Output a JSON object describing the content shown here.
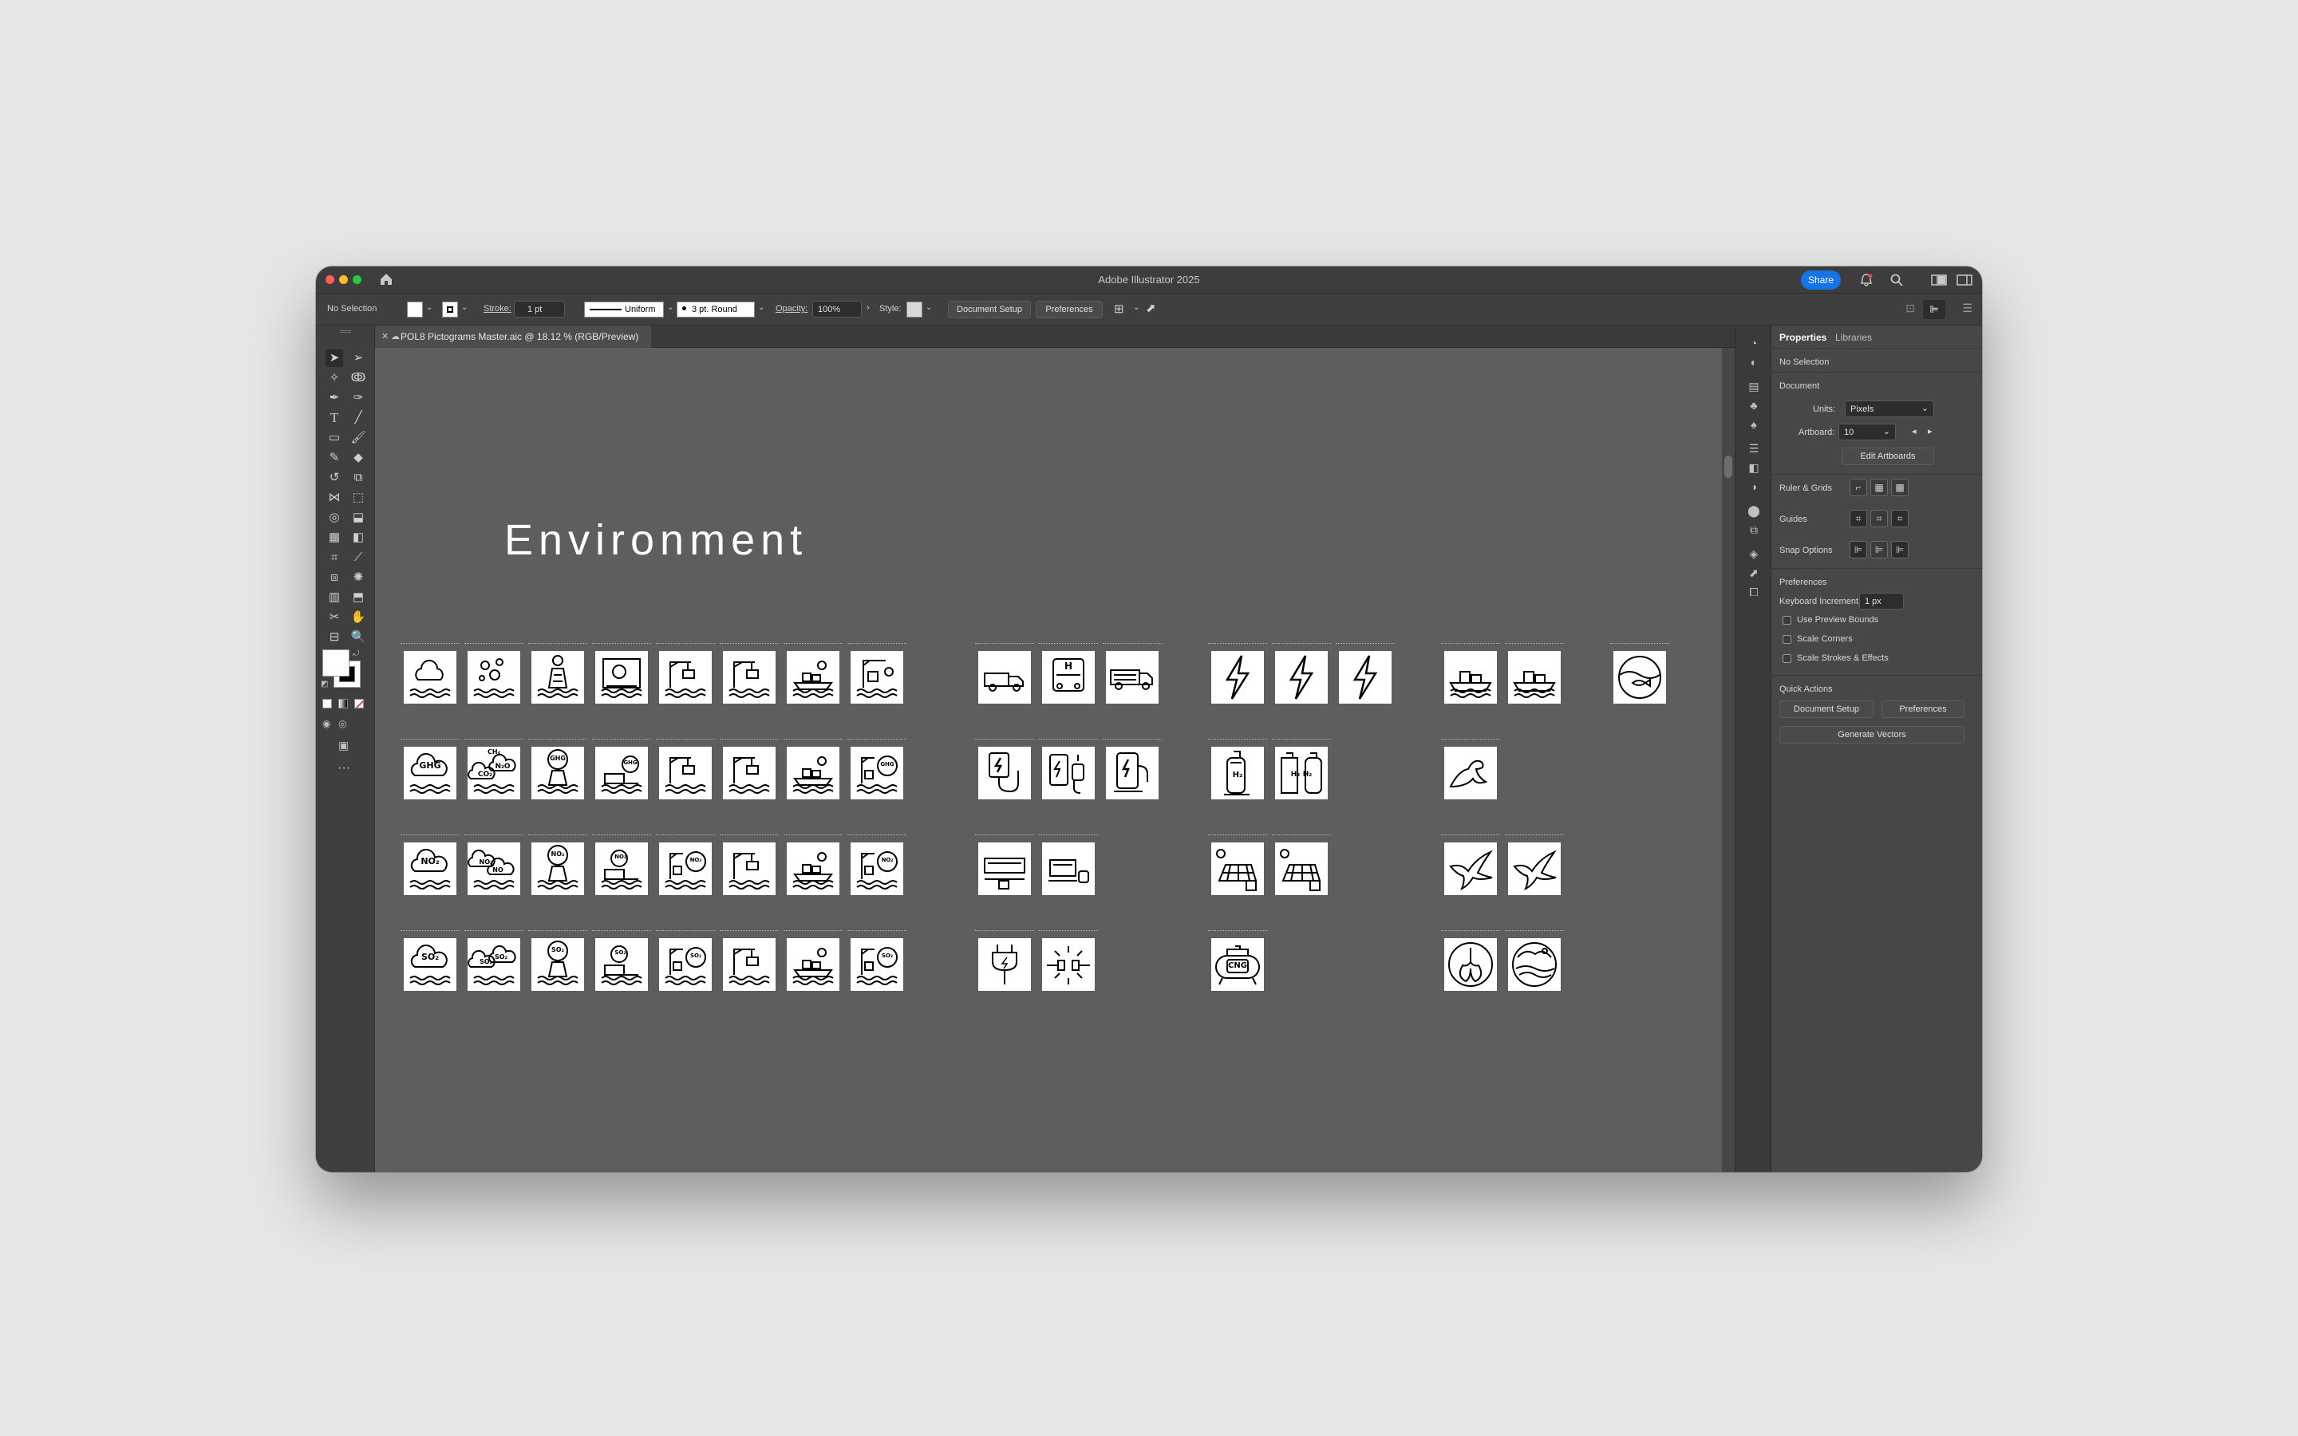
{
  "window": {
    "title": "Adobe Illustrator 2025",
    "share_label": "Share",
    "traffic_colors": [
      "#ff5f57",
      "#febc2e",
      "#28c840"
    ]
  },
  "control_bar": {
    "selection": "No Selection",
    "stroke_label": "Stroke:",
    "stroke_value": "1 pt",
    "stroke_profile": "Uniform",
    "brush": "3 pt. Round",
    "opacity_label": "Opacity:",
    "opacity_value": "100%",
    "style_label": "Style:",
    "document_setup": "Document Setup",
    "preferences": "Preferences"
  },
  "document_tab": {
    "title": "POL8 Pictograms Master.aic @ 18.12 % (RGB/Preview)"
  },
  "canvas": {
    "heading": "Environment",
    "artboard_label_text": "Pictogram label (illegible at 18.12%)",
    "accent": "#000000"
  },
  "properties_panel": {
    "tab_properties": "Properties",
    "tab_libraries": "Libraries",
    "selection": "No Selection",
    "document_header": "Document",
    "units_label": "Units:",
    "units_value": "Pixels",
    "artboard_label": "Artboard:",
    "artboard_value": "10",
    "edit_artboards": "Edit Artboards",
    "rulers_grids": "Ruler & Grids",
    "guides": "Guides",
    "snap_options": "Snap Options",
    "preferences_header": "Preferences",
    "keyboard_increment_label": "Keyboard Increment:",
    "keyboard_increment_value": "1 px",
    "use_preview_bounds": "Use Preview Bounds",
    "scale_corners": "Scale Corners",
    "scale_strokes_effects": "Scale Strokes & Effects",
    "quick_actions": "Quick Actions",
    "document_setup": "Document Setup",
    "preferences": "Preferences",
    "generate_vectors": "Generate Vectors"
  },
  "pictogram_texts": {
    "ghg": "GHG",
    "ch4": "CH₄",
    "co2": "CO₂",
    "n2o": "N₂O",
    "no2": "NO₂",
    "no": "NO",
    "so2": "SO₂",
    "h": "H",
    "h2": "H₂",
    "cng": "CNG"
  },
  "icons": {
    "close": "✕",
    "home": "⌂",
    "search": "⌕",
    "bell": "🔔"
  }
}
